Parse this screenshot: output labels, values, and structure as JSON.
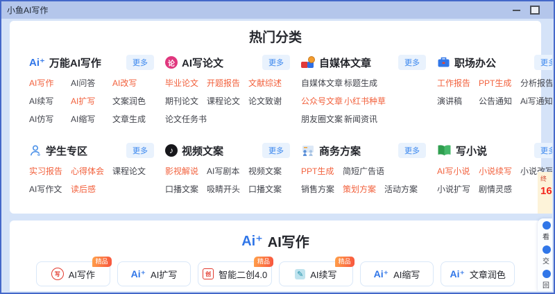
{
  "window": {
    "title": "小鱼AI写作"
  },
  "hot_categories": {
    "title": "热门分类",
    "more_label": "更多",
    "sections": [
      {
        "name": "万能AI写作",
        "icon": "aiplus",
        "rows": [
          [
            {
              "label": "AI写作",
              "hot": true
            },
            {
              "label": "AI问答",
              "hot": false
            },
            {
              "label": "AI改写",
              "hot": true
            }
          ],
          [
            {
              "label": "AI续写",
              "hot": false
            },
            {
              "label": "AI扩写",
              "hot": true
            },
            {
              "label": "文案润色",
              "hot": false
            }
          ],
          [
            {
              "label": "AI仿写",
              "hot": false
            },
            {
              "label": "AI缩写",
              "hot": false
            },
            {
              "label": "文章生成",
              "hot": false
            }
          ]
        ]
      },
      {
        "name": "AI写论文",
        "icon": "paper",
        "rows": [
          [
            {
              "label": "毕业论文",
              "hot": true
            },
            {
              "label": "开题报告",
              "hot": true
            },
            {
              "label": "文献综述",
              "hot": true
            }
          ],
          [
            {
              "label": "期刊论文",
              "hot": false
            },
            {
              "label": "课程论文",
              "hot": false
            },
            {
              "label": "论文致谢",
              "hot": false
            }
          ],
          [
            {
              "label": "论文任务书",
              "hot": false
            }
          ]
        ]
      },
      {
        "name": "自媒体文章",
        "icon": "media",
        "rows": [
          [
            {
              "label": "自媒体文章",
              "hot": false
            },
            {
              "label": "标题生成",
              "hot": false
            }
          ],
          [
            {
              "label": "公众号文章",
              "hot": true
            },
            {
              "label": "小红书种草",
              "hot": true
            }
          ],
          [
            {
              "label": "朋友圈文案",
              "hot": false
            },
            {
              "label": "新闻资讯",
              "hot": false
            }
          ]
        ]
      },
      {
        "name": "职场办公",
        "icon": "briefcase",
        "rows": [
          [
            {
              "label": "工作报告",
              "hot": true
            },
            {
              "label": "PPT生成",
              "hot": true
            },
            {
              "label": "分析报告",
              "hot": false
            }
          ],
          [
            {
              "label": "演讲稿",
              "hot": false
            },
            {
              "label": "公告通知",
              "hot": false
            },
            {
              "label": "Ai写通知",
              "hot": false
            }
          ]
        ]
      },
      {
        "name": "学生专区",
        "icon": "student",
        "rows": [
          [
            {
              "label": "实习报告",
              "hot": true
            },
            {
              "label": "心得体会",
              "hot": true
            },
            {
              "label": "课程论文",
              "hot": false
            }
          ],
          [
            {
              "label": "AI写作文",
              "hot": false
            },
            {
              "label": "读后感",
              "hot": true
            }
          ]
        ]
      },
      {
        "name": "视频文案",
        "icon": "tiktok",
        "rows": [
          [
            {
              "label": "影视解说",
              "hot": true
            },
            {
              "label": "AI写剧本",
              "hot": false
            },
            {
              "label": "视频文案",
              "hot": false
            }
          ],
          [
            {
              "label": "口播文案",
              "hot": false
            },
            {
              "label": "吸睛开头",
              "hot": false
            },
            {
              "label": "口播文案",
              "hot": false
            }
          ]
        ]
      },
      {
        "name": "商务方案",
        "icon": "business",
        "rows": [
          [
            {
              "label": "PPT生成",
              "hot": true
            },
            {
              "label": "简短广告语",
              "hot": false
            }
          ],
          [
            {
              "label": "销售方案",
              "hot": false
            },
            {
              "label": "策划方案",
              "hot": true
            },
            {
              "label": "活动方案",
              "hot": false
            }
          ]
        ]
      },
      {
        "name": "写小说",
        "icon": "novel",
        "rows": [
          [
            {
              "label": "AI写小说",
              "hot": true
            },
            {
              "label": "小说续写",
              "hot": true
            },
            {
              "label": "小说改写",
              "hot": false
            }
          ],
          [
            {
              "label": "小说扩写",
              "hot": false
            },
            {
              "label": "剧情灵感",
              "hot": false
            }
          ]
        ]
      }
    ]
  },
  "ai_writing": {
    "logo": "Ai⁺",
    "title": "AI写作",
    "buttons": [
      {
        "label": "AI写作",
        "icon": "red-circle",
        "badge": "精品"
      },
      {
        "label": "AI扩写",
        "icon": "aiplus",
        "badge": null
      },
      {
        "label": "智能二创4.0",
        "icon": "red-square",
        "badge": "精品"
      },
      {
        "label": "AI续写",
        "icon": "pen",
        "badge": "精品"
      },
      {
        "label": "AI缩写",
        "icon": "aiplus",
        "badge": null
      },
      {
        "label": "文章润色",
        "icon": "aiplus",
        "badge": null
      }
    ]
  },
  "side_widget": {
    "promo_text": "终",
    "promo_number": "16",
    "items": [
      "看",
      "交",
      "回"
    ]
  },
  "icon_defs": {
    "aiplus": {
      "text": "Ai⁺"
    },
    "paper": {
      "text": "论"
    },
    "tiktok": {
      "text": "♪"
    },
    "red-circle": {
      "text": "写"
    },
    "red-square": {
      "text": "创"
    },
    "pen": {
      "text": "✎"
    }
  },
  "colors": {
    "accent_blue": "#3076e8",
    "hot_orange": "#f2613d",
    "badge_gradient_start": "#ffa14a",
    "badge_gradient_end": "#f8543e",
    "titlebar": "#b4c6eb",
    "window_border": "#4468c9",
    "background": "#d5e3f8"
  }
}
